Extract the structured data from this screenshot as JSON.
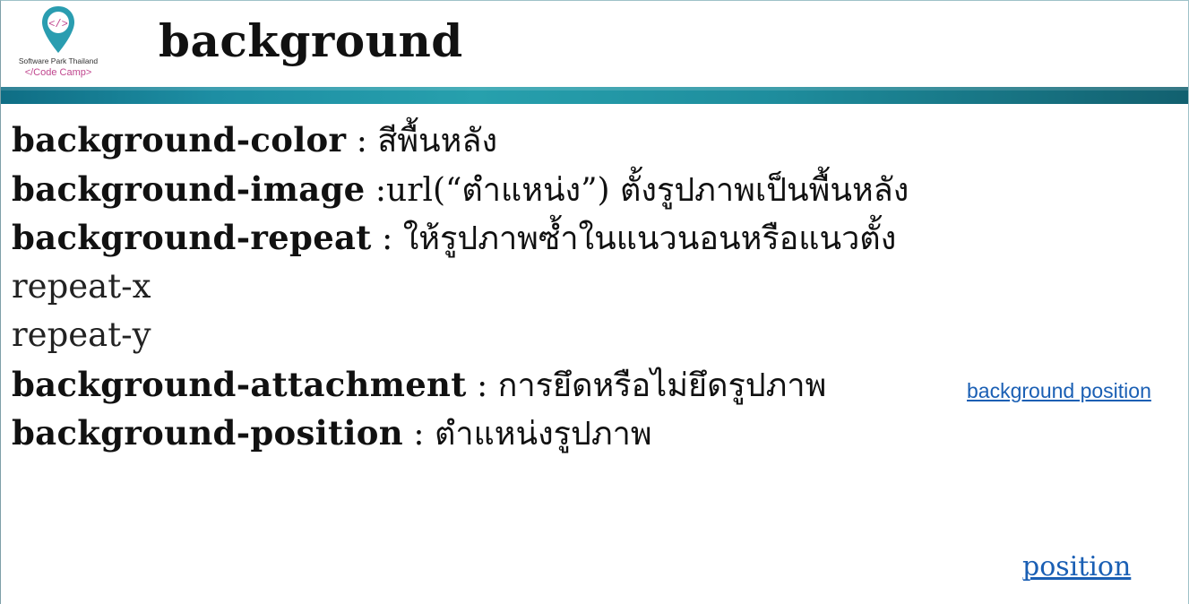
{
  "logo": {
    "icon": "code-map-pin-icon",
    "org_name": "Software Park Thailand",
    "brand": "</Code Camp>",
    "accent_color": "#2a9db0",
    "brand_color": "#c0468e"
  },
  "header": {
    "title": "background",
    "band_color": "#1d8ea3"
  },
  "lines": [
    {
      "prop": "background-color",
      "desc": " : สีพื้นหลัง"
    },
    {
      "prop": "background-image",
      "desc": " :url(“ตำแหน่ง”) ตั้งรูปภาพเป็นพื้นหลัง"
    },
    {
      "prop": "background-repeat",
      "desc": " : ให้รูปภาพซ้ำในแนวนอนหรือแนวตั้ง"
    },
    {
      "plain": "repeat-x"
    },
    {
      "plain": "repeat-y"
    },
    {
      "prop": "background-attachment",
      "desc": " : การยึดหรือไม่ยึดรูปภาพ"
    },
    {
      "prop": "background-position",
      "desc": " : ตำแหน่งรูปภาพ"
    }
  ],
  "links": {
    "side": "background position",
    "bottom": "position"
  }
}
